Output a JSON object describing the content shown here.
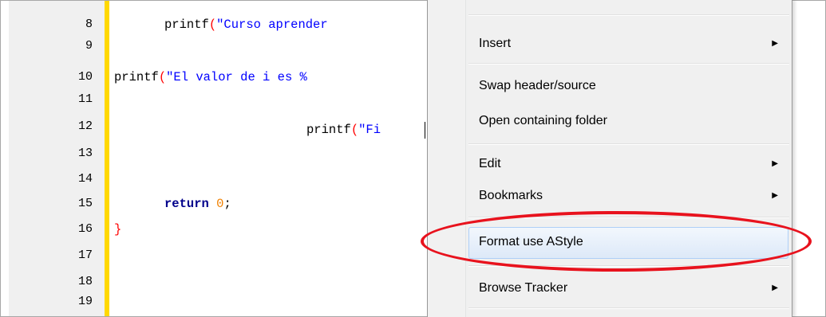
{
  "editor": {
    "line_numbers": [
      "8",
      "9",
      "10",
      "11",
      "12",
      "13",
      "14",
      "15",
      "16",
      "17",
      "18",
      "19"
    ],
    "line8_fn": "printf",
    "line8_paren": "(",
    "line8_str": "\"Curso aprender",
    "line10_fn": "printf",
    "line10_paren": "(",
    "line10_str": "\"El valor de i es %",
    "line12_fn": "printf",
    "line12_paren": "(",
    "line12_str": "\"Fi",
    "line15_kw": "return",
    "line15_num": "0",
    "line15_semi": ";",
    "line16_brace": "}"
  },
  "context_menu": {
    "items": [
      {
        "label": "Insert",
        "submenu": true
      },
      {
        "label": "Swap header/source",
        "submenu": false
      },
      {
        "label": "Open containing folder",
        "submenu": false
      },
      {
        "label": "Edit",
        "submenu": true
      },
      {
        "label": "Bookmarks",
        "submenu": true
      },
      {
        "label": "Format use AStyle",
        "submenu": false,
        "highlighted": true
      },
      {
        "label": "Browse Tracker",
        "submenu": true
      }
    ],
    "submenu_arrow": "▶"
  },
  "colors": {
    "annotation_ellipse": "#e8121d",
    "change_bar": "#ffd800",
    "string": "#0000ff",
    "keyword": "#00008b"
  }
}
